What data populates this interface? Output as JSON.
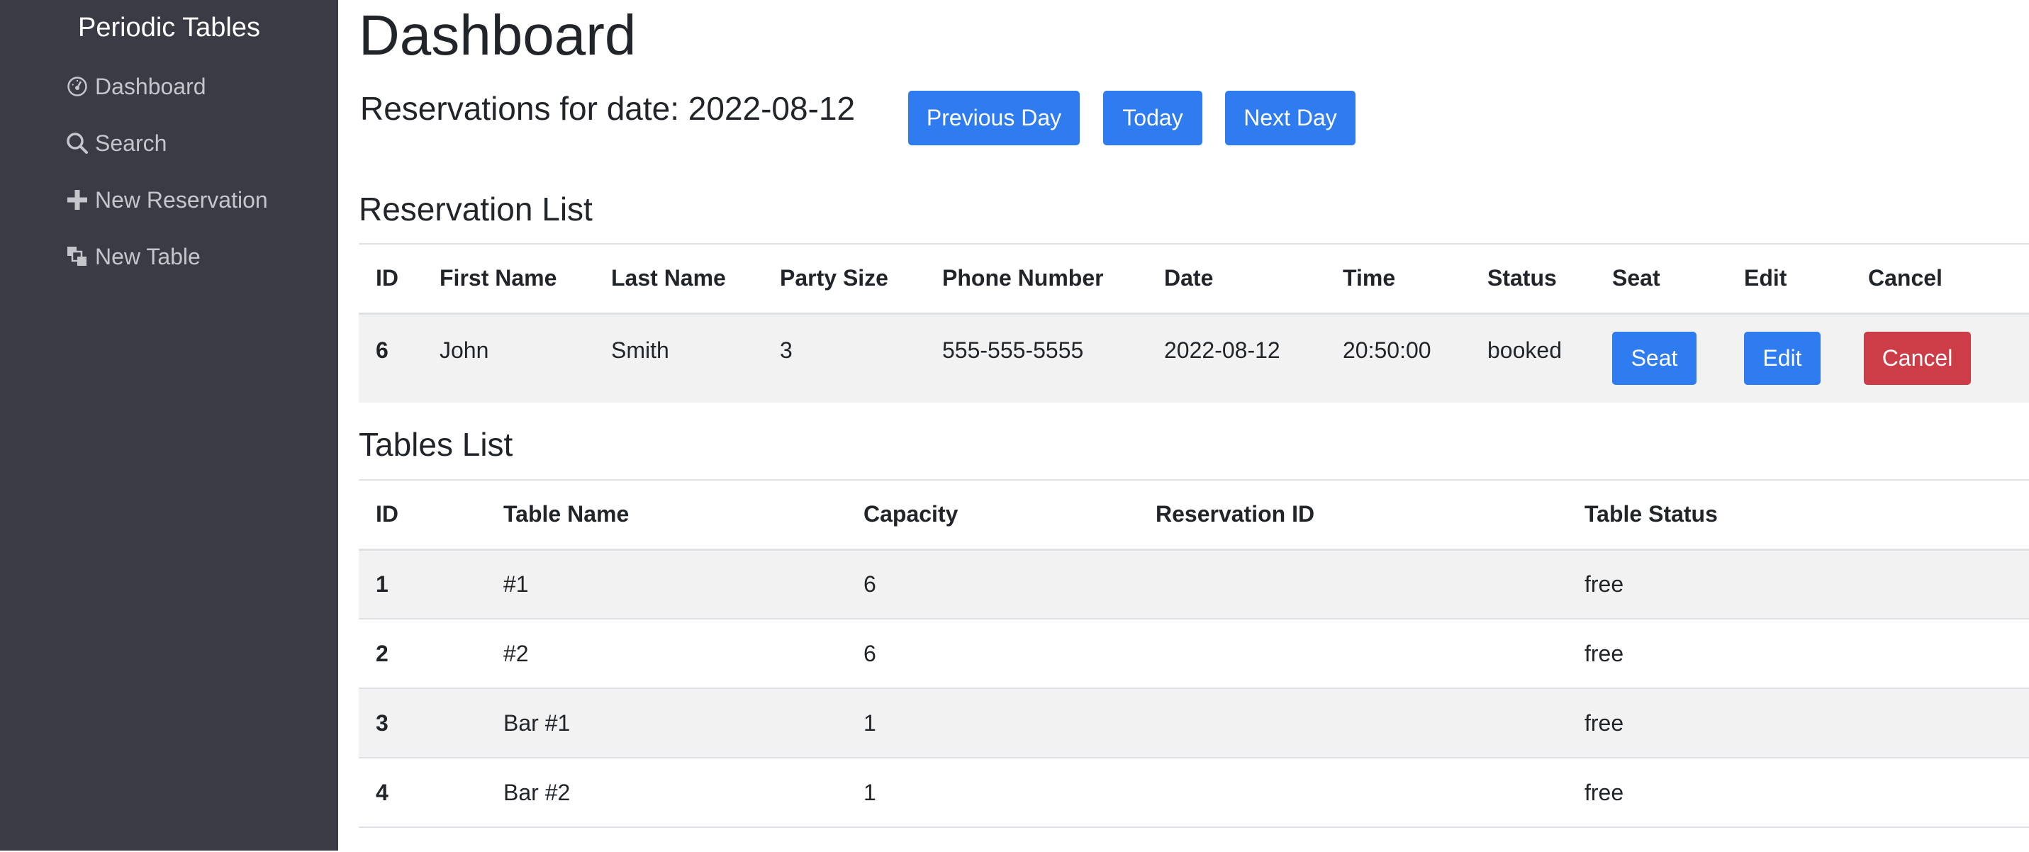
{
  "sidebar": {
    "brand": "Periodic Tables",
    "items": [
      {
        "label": "Dashboard",
        "icon": "dashboard-icon"
      },
      {
        "label": "Search",
        "icon": "search-icon"
      },
      {
        "label": "New Reservation",
        "icon": "plus-icon"
      },
      {
        "label": "New Table",
        "icon": "table-icon"
      }
    ]
  },
  "header": {
    "title": "Dashboard",
    "date_heading": "Reservations for date: 2022-08-12",
    "prev_label": "Previous Day",
    "today_label": "Today",
    "next_label": "Next Day"
  },
  "reservations": {
    "title": "Reservation List",
    "columns": [
      "ID",
      "First Name",
      "Last Name",
      "Party Size",
      "Phone Number",
      "Date",
      "Time",
      "Status",
      "Seat",
      "Edit",
      "Cancel"
    ],
    "rows": [
      {
        "id": "6",
        "first_name": "John",
        "last_name": "Smith",
        "party_size": "3",
        "phone": "555-555-5555",
        "date": "2022-08-12",
        "time": "20:50:00",
        "status": "booked",
        "seat_label": "Seat",
        "edit_label": "Edit",
        "cancel_label": "Cancel"
      }
    ]
  },
  "tables": {
    "title": "Tables List",
    "columns": [
      "ID",
      "Table Name",
      "Capacity",
      "Reservation ID",
      "Table Status"
    ],
    "rows": [
      {
        "id": "1",
        "name": "#1",
        "capacity": "6",
        "reservation_id": "",
        "status": "free"
      },
      {
        "id": "2",
        "name": "#2",
        "capacity": "6",
        "reservation_id": "",
        "status": "free"
      },
      {
        "id": "3",
        "name": "Bar #1",
        "capacity": "1",
        "reservation_id": "",
        "status": "free"
      },
      {
        "id": "4",
        "name": "Bar #2",
        "capacity": "1",
        "reservation_id": "",
        "status": "free"
      }
    ]
  },
  "colors": {
    "sidebar_bg": "#3a3b45",
    "primary": "#2f7bf0",
    "danger": "#cd3d48",
    "stripe": "#f2f2f2"
  }
}
